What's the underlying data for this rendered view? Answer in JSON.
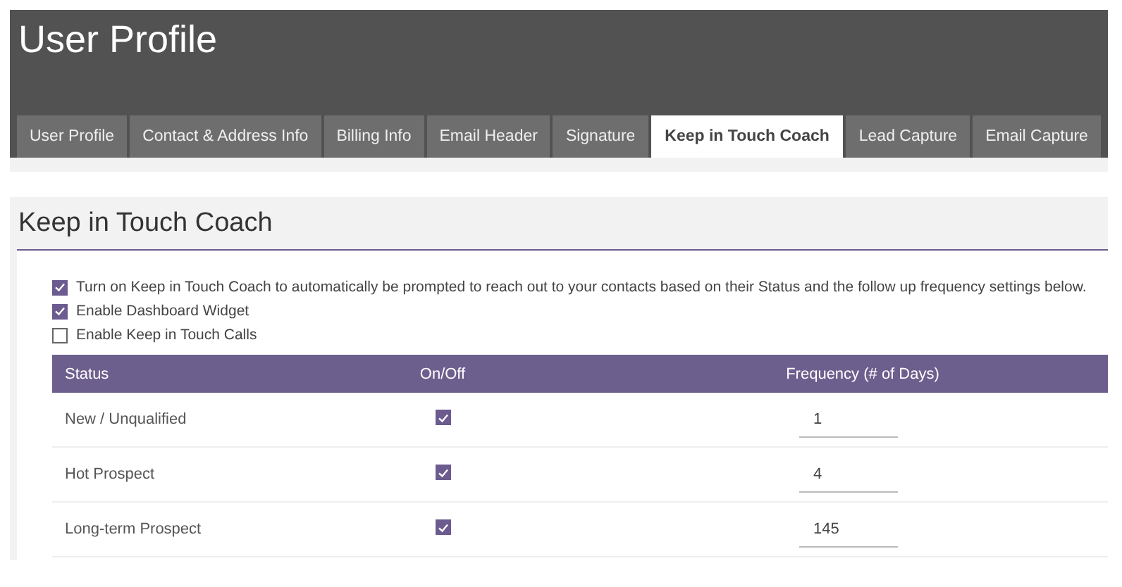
{
  "header": {
    "title": "User Profile"
  },
  "tabs": [
    {
      "label": "User Profile",
      "selected": false
    },
    {
      "label": "Contact & Address Info",
      "selected": false
    },
    {
      "label": "Billing Info",
      "selected": false
    },
    {
      "label": "Email Header",
      "selected": false
    },
    {
      "label": "Signature",
      "selected": false
    },
    {
      "label": "Keep in Touch Coach",
      "selected": true
    },
    {
      "label": "Lead Capture",
      "selected": false
    },
    {
      "label": "Email Capture",
      "selected": false
    }
  ],
  "panel": {
    "title": "Keep in Touch Coach",
    "options": [
      {
        "label": "Turn on Keep in Touch Coach to automatically be prompted to reach out to your contacts based on their Status and the follow up frequency settings below.",
        "checked": true
      },
      {
        "label": "Enable Dashboard Widget",
        "checked": true
      },
      {
        "label": "Enable Keep in Touch Calls",
        "checked": false
      }
    ],
    "table": {
      "columns": [
        "Status",
        "On/Off",
        "Frequency (# of Days)"
      ],
      "rows": [
        {
          "status": "New / Unqualified",
          "checked": true,
          "frequency": "1"
        },
        {
          "status": "Hot Prospect",
          "checked": true,
          "frequency": "4"
        },
        {
          "status": "Long-term Prospect",
          "checked": true,
          "frequency": "145"
        }
      ]
    }
  }
}
